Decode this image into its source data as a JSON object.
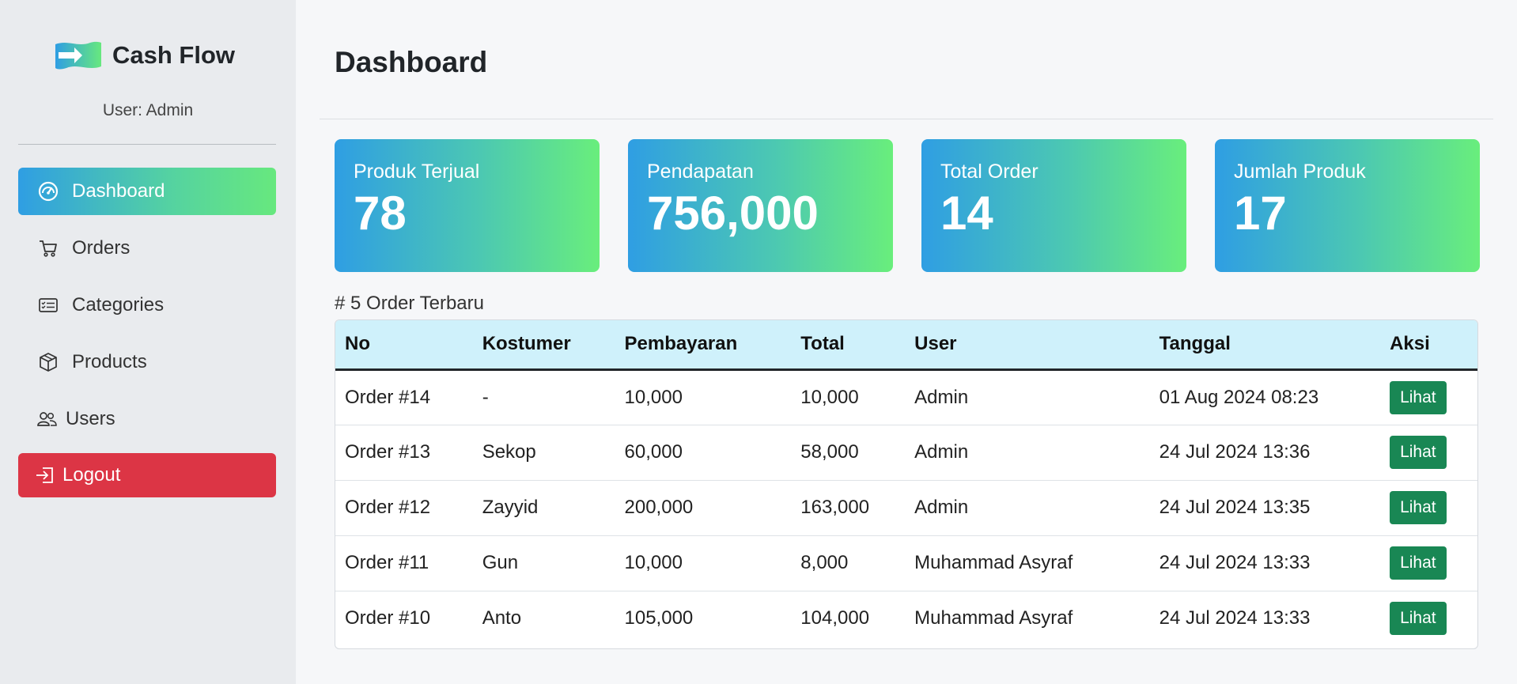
{
  "brand": {
    "name": "Cash Flow",
    "user_line": "User: Admin"
  },
  "sidebar": {
    "items": [
      {
        "label": "Dashboard",
        "icon": "gauge-icon",
        "active": true
      },
      {
        "label": "Orders",
        "icon": "cart-icon"
      },
      {
        "label": "Categories",
        "icon": "list-card-icon"
      },
      {
        "label": "Products",
        "icon": "box-icon"
      },
      {
        "label": "Users",
        "icon": "people-icon"
      }
    ],
    "logout_label": "Logout"
  },
  "page": {
    "title": "Dashboard"
  },
  "stats": [
    {
      "label": "Produk Terjual",
      "value": "78"
    },
    {
      "label": "Pendapatan",
      "value": "756,000"
    },
    {
      "label": "Total Order",
      "value": "14"
    },
    {
      "label": "Jumlah Produk",
      "value": "17"
    }
  ],
  "recent_orders": {
    "title": "# 5 Order Terbaru",
    "columns": [
      "No",
      "Kostumer",
      "Pembayaran",
      "Total",
      "User",
      "Tanggal",
      "Aksi"
    ],
    "rows": [
      {
        "no": "Order #14",
        "kostumer": "-",
        "pembayaran": "10,000",
        "total": "10,000",
        "user": "Admin",
        "tanggal": "01 Aug 2024 08:23",
        "aksi": "Lihat"
      },
      {
        "no": "Order #13",
        "kostumer": "Sekop",
        "pembayaran": "60,000",
        "total": "58,000",
        "user": "Admin",
        "tanggal": "24 Jul 2024 13:36",
        "aksi": "Lihat"
      },
      {
        "no": "Order #12",
        "kostumer": "Zayyid",
        "pembayaran": "200,000",
        "total": "163,000",
        "user": "Admin",
        "tanggal": "24 Jul 2024 13:35",
        "aksi": "Lihat"
      },
      {
        "no": "Order #11",
        "kostumer": "Gun",
        "pembayaran": "10,000",
        "total": "8,000",
        "user": "Muhammad Asyraf",
        "tanggal": "24 Jul 2024 13:33",
        "aksi": "Lihat"
      },
      {
        "no": "Order #10",
        "kostumer": "Anto",
        "pembayaran": "105,000",
        "total": "104,000",
        "user": "Muhammad Asyraf",
        "tanggal": "24 Jul 2024 13:33",
        "aksi": "Lihat"
      }
    ]
  },
  "colors": {
    "accent_gradient_start": "#2f9ee3",
    "accent_gradient_end": "#67e87e",
    "logout": "#dc3545",
    "action_button": "#198754",
    "table_header": "#cff1fb"
  }
}
